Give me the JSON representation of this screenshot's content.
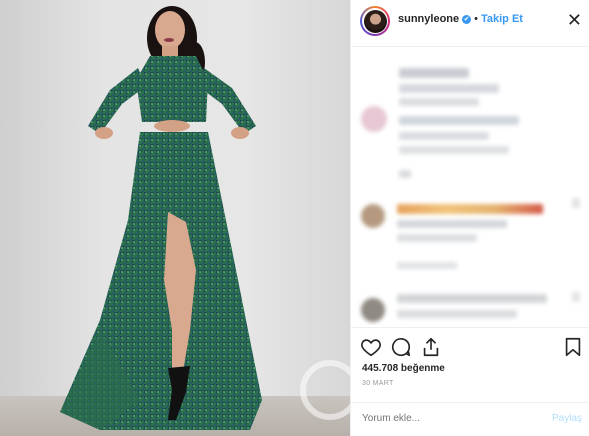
{
  "photo": {
    "alt": ""
  },
  "header": {
    "username": "sunnyleone",
    "verified_mark": "✔",
    "separator": "•",
    "follow_label": "Takip Et",
    "close_glyph": "✕"
  },
  "post": {
    "likes": "445.708 beğenme",
    "date": "30 MART"
  },
  "comment_box": {
    "placeholder": "Yorum ekle...",
    "post_label": "Paylaş"
  },
  "colors": {
    "accent": "#3897f0",
    "post_disabled": "#b2dffc",
    "text": "#262626"
  },
  "icons": [
    "heart-icon",
    "comment-icon",
    "share-icon",
    "bookmark-icon",
    "close-icon",
    "verified-badge-icon"
  ]
}
